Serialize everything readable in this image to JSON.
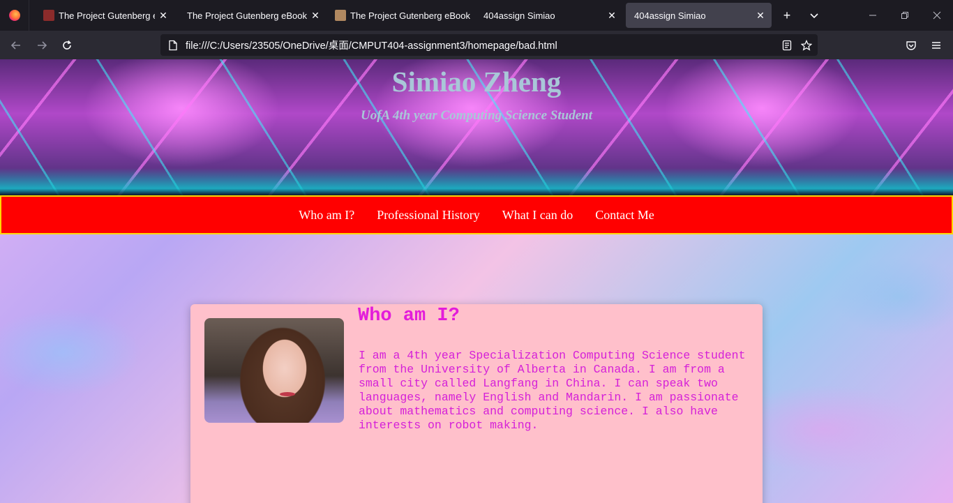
{
  "browser": {
    "tabs": [
      {
        "title": "The Project Gutenberg eBook",
        "favicon_color": "#8b2b2b",
        "active": false
      },
      {
        "title": "The Project Gutenberg eBook of",
        "favicon_color": "",
        "active": false
      },
      {
        "title": "The Project Gutenberg eBook",
        "favicon_color": "#b08860",
        "active": false
      },
      {
        "title": "404assign Simiao",
        "favicon_color": "",
        "active": false
      },
      {
        "title": "404assign Simiao",
        "favicon_color": "",
        "active": true
      }
    ],
    "close_glyph": "✕",
    "new_tab_glyph": "+",
    "tab_list_glyph": "⌄",
    "url": "file:///C:/Users/23505/OneDrive/桌面/CMPUT404-assignment3/homepage/bad.html"
  },
  "header": {
    "title": "Simiao Zheng",
    "subtitle": "UofA 4th year Computing Science Student"
  },
  "nav": {
    "items": [
      "Who am I?",
      "Professional History",
      "What I can do",
      "Contact Me"
    ]
  },
  "about": {
    "heading": "Who am I?",
    "body": "I am a 4th year Specialization Computing Science student from the University of Alberta in Canada. I am from a small city called Langfang in China. I can speak two languages, namely English and Mandarin. I am passionate about mathematics and computing science. I also have interests on robot making."
  },
  "colors": {
    "nav_bg": "#ff0000",
    "nav_border": "#ffd800",
    "card_bg": "#ffc0cb",
    "card_text": "#d51fd8",
    "banner_text": "#a9c7d8"
  }
}
